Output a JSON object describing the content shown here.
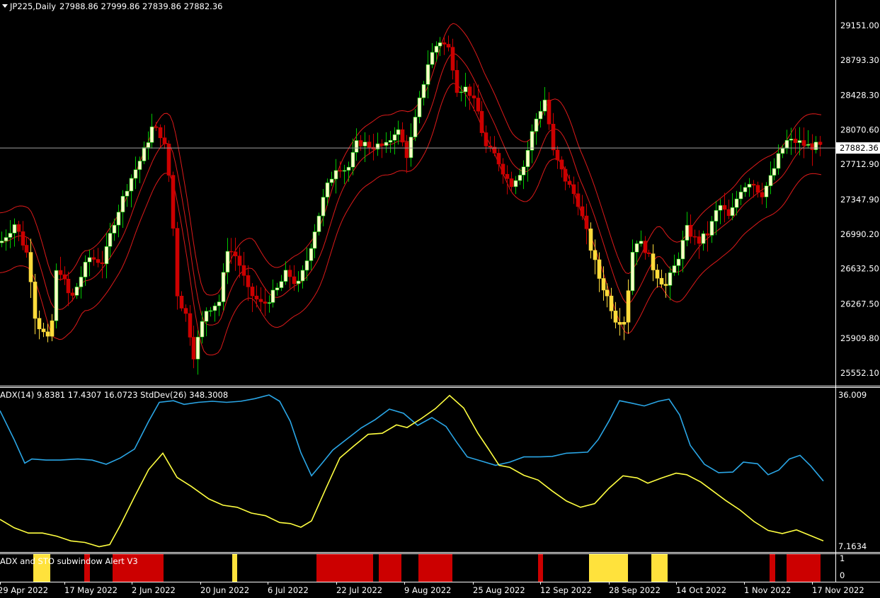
{
  "header": {
    "symbol": "JP225,Daily",
    "ohlc": "27988.86 27999.86 27839.86 27882.36",
    "ind_header": "ADX(14) 9.8381 17.4307 16.0723  StdDev(26) 348.3008",
    "alert_header": "ADX and STO subwindow Alert V3"
  },
  "colors": {
    "background": "#000000",
    "frame": "#ffffff",
    "bull_wick": "#00c800",
    "bull_body": "#ffffc8",
    "bear": "#cc0000",
    "weak_trend": "#ffdc3c",
    "bands": "#dd1a1a",
    "price_line": "#a0a0a0",
    "adx_line": "#2aa6e6",
    "std_line": "#ffff40",
    "alert_red": "#cc0000",
    "alert_yellow": "#ffe23c"
  },
  "chart_data": [
    {
      "type": "candlestick",
      "panel": "main",
      "y_ticks": [
        "29151.00",
        "28793.30",
        "28428.30",
        "28070.60",
        "27712.90",
        "27347.90",
        "26990.20",
        "26632.50",
        "26267.50",
        "25909.80",
        "25552.10"
      ],
      "last_price": "27882.36",
      "x_ticks": [
        "29 Apr 2022",
        "17 May 2022",
        "2 Jun 2022",
        "20 Jun 2022",
        "6 Jul 2022",
        "22 Jul 2022",
        "9 Aug 2022",
        "25 Aug 2022",
        "12 Sep 2022",
        "28 Sep 2022",
        "14 Oct 2022",
        "1 Nov 2022",
        "17 Nov 2022"
      ],
      "price_anchors": [
        {
          "x": 0,
          "p": 26900
        },
        {
          "x": 20,
          "p": 27100
        },
        {
          "x": 40,
          "p": 26750
        },
        {
          "x": 50,
          "p": 26100
        },
        {
          "x": 70,
          "p": 25850
        },
        {
          "x": 80,
          "p": 26700
        },
        {
          "x": 100,
          "p": 26300
        },
        {
          "x": 125,
          "p": 26750
        },
        {
          "x": 145,
          "p": 26700
        },
        {
          "x": 160,
          "p": 27100
        },
        {
          "x": 180,
          "p": 27500
        },
        {
          "x": 200,
          "p": 27800
        },
        {
          "x": 215,
          "p": 28100
        },
        {
          "x": 230,
          "p": 28000
        },
        {
          "x": 240,
          "p": 27500
        },
        {
          "x": 250,
          "p": 26350
        },
        {
          "x": 265,
          "p": 26100
        },
        {
          "x": 272,
          "p": 25700
        },
        {
          "x": 290,
          "p": 26200
        },
        {
          "x": 310,
          "p": 26300
        },
        {
          "x": 320,
          "p": 26850
        },
        {
          "x": 335,
          "p": 26750
        },
        {
          "x": 350,
          "p": 26400
        },
        {
          "x": 370,
          "p": 26250
        },
        {
          "x": 390,
          "p": 26400
        },
        {
          "x": 405,
          "p": 26600
        },
        {
          "x": 420,
          "p": 26450
        },
        {
          "x": 430,
          "p": 26650
        },
        {
          "x": 445,
          "p": 27050
        },
        {
          "x": 460,
          "p": 27450
        },
        {
          "x": 475,
          "p": 27700
        },
        {
          "x": 490,
          "p": 27650
        },
        {
          "x": 505,
          "p": 27950
        },
        {
          "x": 525,
          "p": 27900
        },
        {
          "x": 545,
          "p": 27900
        },
        {
          "x": 560,
          "p": 28100
        },
        {
          "x": 575,
          "p": 27800
        },
        {
          "x": 590,
          "p": 28300
        },
        {
          "x": 605,
          "p": 28800
        },
        {
          "x": 620,
          "p": 29000
        },
        {
          "x": 635,
          "p": 28900
        },
        {
          "x": 645,
          "p": 28500
        },
        {
          "x": 660,
          "p": 28500
        },
        {
          "x": 675,
          "p": 28250
        },
        {
          "x": 685,
          "p": 27900
        },
        {
          "x": 700,
          "p": 27800
        },
        {
          "x": 720,
          "p": 27500
        },
        {
          "x": 740,
          "p": 27700
        },
        {
          "x": 755,
          "p": 28150
        },
        {
          "x": 770,
          "p": 28400
        },
        {
          "x": 780,
          "p": 27850
        },
        {
          "x": 795,
          "p": 27600
        },
        {
          "x": 815,
          "p": 27350
        },
        {
          "x": 830,
          "p": 26950
        },
        {
          "x": 845,
          "p": 26550
        },
        {
          "x": 860,
          "p": 26300
        },
        {
          "x": 870,
          "p": 26100
        },
        {
          "x": 882,
          "p": 26100
        },
        {
          "x": 895,
          "p": 26950
        },
        {
          "x": 910,
          "p": 26850
        },
        {
          "x": 925,
          "p": 26600
        },
        {
          "x": 940,
          "p": 26450
        },
        {
          "x": 955,
          "p": 26700
        },
        {
          "x": 970,
          "p": 27050
        },
        {
          "x": 985,
          "p": 26900
        },
        {
          "x": 1000,
          "p": 27000
        },
        {
          "x": 1015,
          "p": 27300
        },
        {
          "x": 1030,
          "p": 27150
        },
        {
          "x": 1045,
          "p": 27450
        },
        {
          "x": 1060,
          "p": 27550
        },
        {
          "x": 1075,
          "p": 27400
        },
        {
          "x": 1090,
          "p": 27600
        },
        {
          "x": 1100,
          "p": 27800
        },
        {
          "x": 1110,
          "p": 27950
        },
        {
          "x": 1125,
          "p": 27950
        },
        {
          "x": 1140,
          "p": 27900
        },
        {
          "x": 1155,
          "p": 27900
        },
        {
          "x": 1165,
          "p": 27880
        }
      ]
    },
    {
      "type": "line",
      "panel": "indicator",
      "y_ticks": [
        "36.009",
        "7.1634"
      ],
      "series": [
        {
          "name": "ADX(14)",
          "points": [
            [
              0,
              33
            ],
            [
              20,
              27.5
            ],
            [
              35,
              23
            ],
            [
              45,
              23.8
            ],
            [
              65,
              23.6
            ],
            [
              85,
              23.6
            ],
            [
              110,
              23.8
            ],
            [
              130,
              23.6
            ],
            [
              150,
              22.8
            ],
            [
              170,
              24
            ],
            [
              190,
              25.7
            ],
            [
              210,
              31
            ],
            [
              225,
              34.6
            ],
            [
              245,
              34.9
            ],
            [
              260,
              34.2
            ],
            [
              280,
              34.6
            ],
            [
              300,
              34.8
            ],
            [
              320,
              34.6
            ],
            [
              340,
              34.8
            ],
            [
              360,
              35.3
            ],
            [
              380,
              36
            ],
            [
              395,
              34.8
            ],
            [
              410,
              31
            ],
            [
              425,
              25
            ],
            [
              440,
              20.6
            ],
            [
              455,
              23
            ],
            [
              470,
              25.5
            ],
            [
              490,
              27.6
            ],
            [
              510,
              29.7
            ],
            [
              530,
              31.3
            ],
            [
              550,
              33.3
            ],
            [
              570,
              32.5
            ],
            [
              590,
              30.2
            ],
            [
              610,
              31.7
            ],
            [
              630,
              30
            ],
            [
              645,
              27
            ],
            [
              660,
              24.2
            ],
            [
              680,
              23.4
            ],
            [
              700,
              22.6
            ],
            [
              720,
              23.2
            ],
            [
              740,
              24.2
            ],
            [
              760,
              24.2
            ],
            [
              780,
              24.3
            ],
            [
              800,
              24.9
            ],
            [
              830,
              25.1
            ],
            [
              845,
              27.5
            ],
            [
              860,
              31
            ],
            [
              875,
              34.9
            ],
            [
              890,
              34.5
            ],
            [
              910,
              33.9
            ],
            [
              930,
              34.8
            ],
            [
              945,
              35.2
            ],
            [
              960,
              32.2
            ],
            [
              975,
              26.4
            ],
            [
              995,
              22.8
            ],
            [
              1015,
              21.2
            ],
            [
              1035,
              21.3
            ],
            [
              1050,
              23.2
            ],
            [
              1070,
              22.9
            ],
            [
              1085,
              20.8
            ],
            [
              1100,
              21.7
            ],
            [
              1115,
              23.8
            ],
            [
              1130,
              24.5
            ],
            [
              1145,
              22.5
            ],
            [
              1163,
              19.6
            ]
          ]
        },
        {
          "name": "StdDev(26)",
          "points": [
            [
              0,
              12.3
            ],
            [
              20,
              10.7
            ],
            [
              40,
              9.7
            ],
            [
              60,
              9.7
            ],
            [
              80,
              9.1
            ],
            [
              100,
              8.2
            ],
            [
              120,
              7.9
            ],
            [
              140,
              7.1
            ],
            [
              155,
              7.5
            ],
            [
              170,
              11.2
            ],
            [
              190,
              16.6
            ],
            [
              210,
              21.8
            ],
            [
              230,
              24.9
            ],
            [
              250,
              20.3
            ],
            [
              270,
              18.6
            ],
            [
              295,
              16.2
            ],
            [
              315,
              15
            ],
            [
              335,
              14.6
            ],
            [
              355,
              13.5
            ],
            [
              375,
              13
            ],
            [
              395,
              11.7
            ],
            [
              410,
              11.5
            ],
            [
              425,
              10.8
            ],
            [
              440,
              12
            ],
            [
              460,
              18.1
            ],
            [
              480,
              24
            ],
            [
              500,
              26.3
            ],
            [
              520,
              28.5
            ],
            [
              540,
              28.7
            ],
            [
              560,
              30.3
            ],
            [
              575,
              29.8
            ],
            [
              595,
              31.5
            ],
            [
              615,
              33.4
            ],
            [
              635,
              35.9
            ],
            [
              655,
              33.5
            ],
            [
              675,
              28.7
            ],
            [
              690,
              25.7
            ],
            [
              705,
              22.6
            ],
            [
              720,
              22.2
            ],
            [
              740,
              20.7
            ],
            [
              760,
              19.8
            ],
            [
              780,
              17.7
            ],
            [
              800,
              15.8
            ],
            [
              820,
              14.6
            ],
            [
              840,
              15.3
            ],
            [
              860,
              18.2
            ],
            [
              880,
              20.6
            ],
            [
              900,
              20.2
            ],
            [
              915,
              19.2
            ],
            [
              935,
              20.2
            ],
            [
              955,
              21.1
            ],
            [
              970,
              20.8
            ],
            [
              990,
              19.4
            ],
            [
              1005,
              17.9
            ],
            [
              1025,
              15.9
            ],
            [
              1045,
              14.1
            ],
            [
              1065,
              11.9
            ],
            [
              1085,
              10.2
            ],
            [
              1105,
              9.6
            ],
            [
              1125,
              10.3
            ],
            [
              1145,
              9.2
            ],
            [
              1163,
              8.2
            ]
          ]
        }
      ]
    },
    {
      "type": "bar",
      "panel": "alert",
      "y_ticks": [
        "1",
        "0"
      ],
      "segments": [
        {
          "from": 47,
          "to": 71,
          "level": "yellow"
        },
        {
          "from": 119,
          "to": 127,
          "level": "red"
        },
        {
          "from": 159,
          "to": 231,
          "level": "red"
        },
        {
          "from": 328,
          "to": 335,
          "level": "yellow"
        },
        {
          "from": 447,
          "to": 527,
          "level": "red"
        },
        {
          "from": 535,
          "to": 567,
          "level": "red"
        },
        {
          "from": 591,
          "to": 639,
          "level": "red"
        },
        {
          "from": 760,
          "to": 767,
          "level": "red"
        },
        {
          "from": 832,
          "to": 887,
          "level": "yellow"
        },
        {
          "from": 920,
          "to": 943,
          "level": "yellow"
        },
        {
          "from": 1087,
          "to": 1095,
          "level": "red"
        },
        {
          "from": 1111,
          "to": 1159,
          "level": "red"
        }
      ]
    }
  ]
}
